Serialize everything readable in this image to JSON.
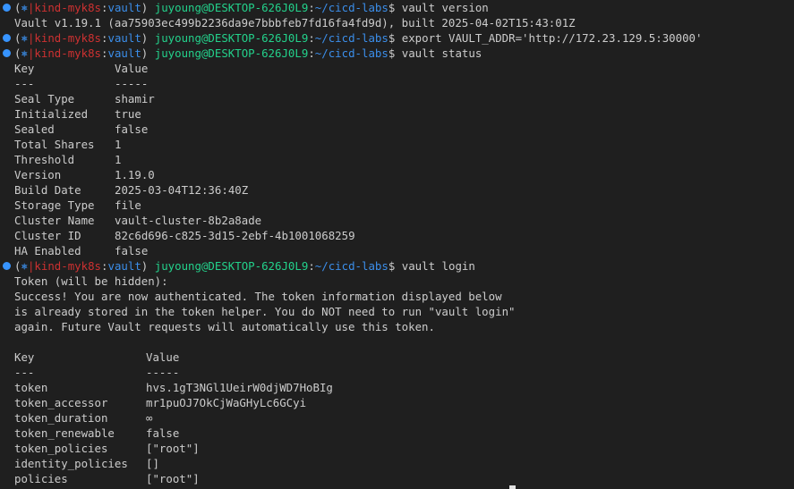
{
  "colors": {
    "background": "#1f1f1f",
    "text": "#cccccc",
    "context": "#cd3131",
    "namespace": "#3b8eea",
    "user_host": "#23d18b",
    "path": "#3b8eea",
    "dot": "#3794ff"
  },
  "icons": {
    "prompt_status": "blue-dot-icon",
    "k8s": "kubernetes-wheel-icon",
    "k8s_glyph": "⎈"
  },
  "prompt": {
    "paren_open": "(",
    "paren_close": ")",
    "separator": "|",
    "context": "kind-myk8s",
    "colon": ":",
    "namespace": "vault",
    "user_host": "juyoung@DESKTOP-626J0L9",
    "path_prefix": ":",
    "path": "~/cicd-labs",
    "symbol": "$"
  },
  "session": [
    {
      "type": "prompt",
      "command": "vault version"
    },
    {
      "type": "out",
      "text": "Vault v1.19.1 (aa75903ec499b2236da9e7bbbfeb7fd16fa4fd9d), built 2025-04-02T15:43:01Z"
    },
    {
      "type": "prompt",
      "command": "export VAULT_ADDR='http://172.23.129.5:30000'"
    },
    {
      "type": "prompt",
      "command": "vault status"
    },
    {
      "type": "kv",
      "key": "Key",
      "value": "Value",
      "w": 112
    },
    {
      "type": "kv",
      "key": "---",
      "value": "-----",
      "w": 112
    },
    {
      "type": "kv",
      "key": "Seal Type",
      "value": "shamir",
      "w": 112
    },
    {
      "type": "kv",
      "key": "Initialized",
      "value": "true",
      "w": 112
    },
    {
      "type": "kv",
      "key": "Sealed",
      "value": "false",
      "w": 112
    },
    {
      "type": "kv",
      "key": "Total Shares",
      "value": "1",
      "w": 112
    },
    {
      "type": "kv",
      "key": "Threshold",
      "value": "1",
      "w": 112
    },
    {
      "type": "kv",
      "key": "Version",
      "value": "1.19.0",
      "w": 112
    },
    {
      "type": "kv",
      "key": "Build Date",
      "value": "2025-03-04T12:36:40Z",
      "w": 112
    },
    {
      "type": "kv",
      "key": "Storage Type",
      "value": "file",
      "w": 112
    },
    {
      "type": "kv",
      "key": "Cluster Name",
      "value": "vault-cluster-8b2a8ade",
      "w": 112
    },
    {
      "type": "kv",
      "key": "Cluster ID",
      "value": "82c6d696-c825-3d15-2ebf-4b1001068259",
      "w": 112
    },
    {
      "type": "kv",
      "key": "HA Enabled",
      "value": "false",
      "w": 112
    },
    {
      "type": "prompt",
      "command": "vault login"
    },
    {
      "type": "out",
      "text": "Token (will be hidden):"
    },
    {
      "type": "out",
      "text": "Success! You are now authenticated. The token information displayed below"
    },
    {
      "type": "out",
      "text": "is already stored in the token helper. You do NOT need to run \"vault login\""
    },
    {
      "type": "out",
      "text": "again. Future Vault requests will automatically use this token."
    },
    {
      "type": "out",
      "text": ""
    },
    {
      "type": "kv",
      "key": "Key",
      "value": "Value",
      "w": 147
    },
    {
      "type": "kv",
      "key": "---",
      "value": "-----",
      "w": 147
    },
    {
      "type": "kv",
      "key": "token",
      "value": "hvs.1gT3NGl1UeirW0djWD7HoBIg",
      "w": 147
    },
    {
      "type": "kv",
      "key": "token_accessor",
      "value": "mr1puOJ7OkCjWaGHyLc6GCyi",
      "w": 147
    },
    {
      "type": "kv",
      "key": "token_duration",
      "value": "∞",
      "w": 147
    },
    {
      "type": "kv",
      "key": "token_renewable",
      "value": "false",
      "w": 147
    },
    {
      "type": "kv",
      "key": "token_policies",
      "value": "[\"root\"]",
      "w": 147
    },
    {
      "type": "kv",
      "key": "identity_policies",
      "value": "[]",
      "w": 147
    },
    {
      "type": "kv",
      "key": "policies",
      "value": "[\"root\"]",
      "w": 147
    }
  ]
}
